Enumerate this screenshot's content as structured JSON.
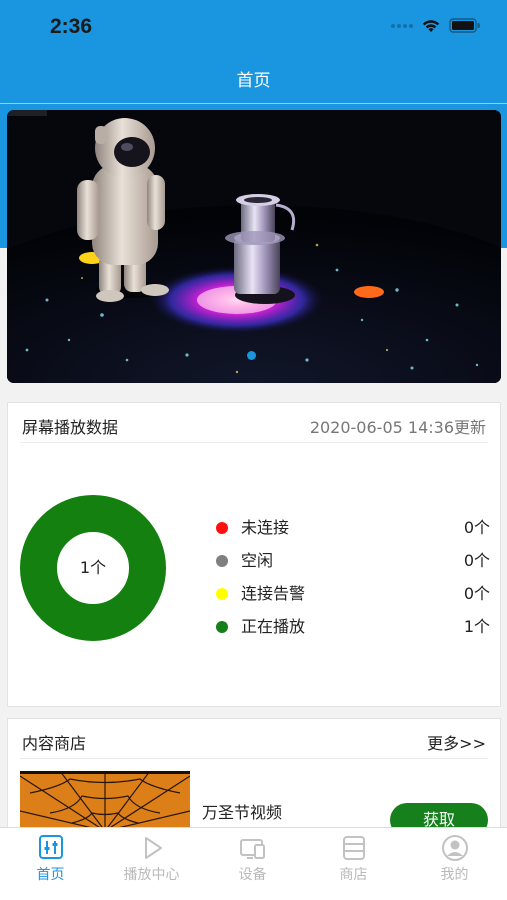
{
  "status_bar": {
    "time": "2:36"
  },
  "nav": {
    "title": "首页"
  },
  "banner": {
    "active_slide": 1,
    "total_slides": 1
  },
  "playback_card": {
    "title": "屏幕播放数据",
    "updated": "2020-06-05 14:36更新",
    "donut_center": "1个",
    "donut_color": "#13800f",
    "legend": [
      {
        "label": "未连接",
        "value": "0个",
        "color": "#ff1010"
      },
      {
        "label": "空闲",
        "value": "0个",
        "color": "#7f7f7f"
      },
      {
        "label": "连接告警",
        "value": "0个",
        "color": "#ffff00"
      },
      {
        "label": "正在播放",
        "value": "1个",
        "color": "#15801a"
      }
    ]
  },
  "store_card": {
    "title": "内容商店",
    "more": "更多>>",
    "items": [
      {
        "title": "万圣节视频",
        "action": "获取"
      }
    ]
  },
  "tabbar": {
    "active": "home",
    "tabs": [
      {
        "label": "首页",
        "icon": "home-sliders-icon"
      },
      {
        "label": "播放中心",
        "icon": "play-icon"
      },
      {
        "label": "设备",
        "icon": "devices-icon"
      },
      {
        "label": "商店",
        "icon": "store-icon"
      },
      {
        "label": "我的",
        "icon": "profile-icon"
      }
    ]
  },
  "colors": {
    "brand": "#1a95e0",
    "action": "#16801c"
  }
}
